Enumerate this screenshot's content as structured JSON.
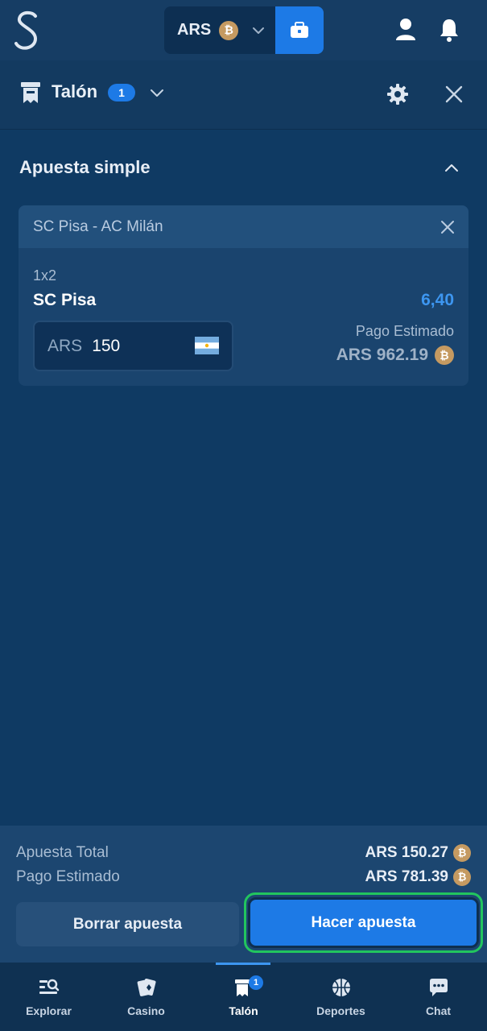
{
  "header": {
    "currency_code": "ARS",
    "coin_symbol": "₿"
  },
  "slip": {
    "title": "Talón",
    "count": "1"
  },
  "section": {
    "title": "Apuesta simple"
  },
  "bet": {
    "event": "SC Pisa - AC Milán",
    "market": "1x2",
    "selection": "SC Pisa",
    "odds": "6,40",
    "stake_currency": "ARS",
    "stake_value": "150",
    "payout_label": "Pago Estimado",
    "payout_value": "ARS 962.19"
  },
  "summary": {
    "total_label": "Apuesta Total",
    "total_value": "ARS 150.27",
    "payout_label": "Pago Estimado",
    "payout_value": "ARS 781.39",
    "clear_button": "Borrar apuesta",
    "place_button": "Hacer apuesta"
  },
  "nav": {
    "items": [
      {
        "label": "Explorar",
        "icon": "explore-icon"
      },
      {
        "label": "Casino",
        "icon": "casino-cards-icon"
      },
      {
        "label": "Talón",
        "icon": "betslip-icon",
        "badge": "1"
      },
      {
        "label": "Deportes",
        "icon": "basketball-icon"
      },
      {
        "label": "Chat",
        "icon": "chat-icon"
      }
    ],
    "active_index": 2
  },
  "colors": {
    "background": "#0f3a63",
    "accent": "#1d7ae6",
    "odds": "#3d96f0",
    "highlight": "#22c55e",
    "coin": "#c59a61"
  }
}
